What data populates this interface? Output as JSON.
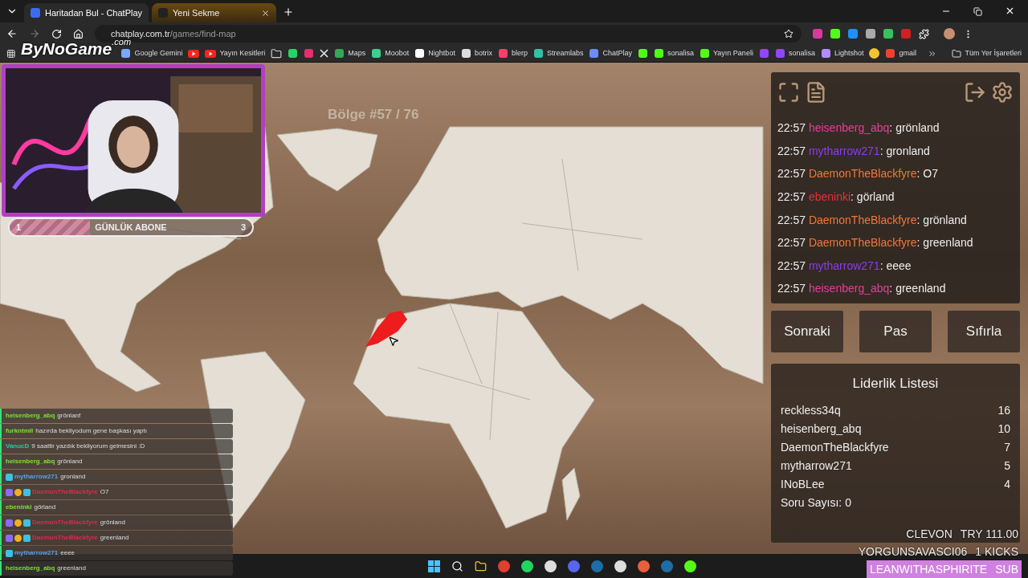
{
  "browser": {
    "tabs": [
      {
        "label": "Haritadan Bul - ChatPlay",
        "selected": true
      },
      {
        "label": "Yeni Sekme",
        "selected": false
      }
    ],
    "address": {
      "host": "chatplay.com.tr",
      "path": "/games/find-map"
    },
    "bookmarks": [
      {
        "kind": "gemini",
        "label": "Google Gemini"
      },
      {
        "kind": "youtube"
      },
      {
        "kind": "youtube",
        "label": "Yayın Kesitleri"
      },
      {
        "kind": "folder"
      },
      {
        "kind": "whatsapp"
      },
      {
        "kind": "instagram"
      },
      {
        "kind": "x"
      },
      {
        "kind": "maps",
        "label": "Maps"
      },
      {
        "kind": "moobot",
        "label": "Moobot"
      },
      {
        "kind": "nightbot",
        "label": "Nightbot"
      },
      {
        "kind": "botrix",
        "label": "botrix"
      },
      {
        "kind": "blerp",
        "label": "blerp"
      },
      {
        "kind": "streamlabs",
        "label": "Streamlabs"
      },
      {
        "kind": "chatplay",
        "label": "ChatPlay"
      },
      {
        "kind": "kick"
      },
      {
        "kind": "kick",
        "label": "sonalisa"
      },
      {
        "kind": "kick",
        "label": "Yayın Paneli"
      },
      {
        "kind": "twitch"
      },
      {
        "kind": "twitch",
        "label": "sonalisa"
      },
      {
        "kind": "lightshot",
        "label": "Lightshot"
      },
      {
        "kind": "emoji"
      },
      {
        "kind": "gmail",
        "label": "gmail"
      }
    ],
    "all_bookmarks": "Tüm Yer İşaretleri"
  },
  "logo": {
    "name": "ByNoGame",
    "suffix": ".com"
  },
  "subscriber_goal": {
    "start": "1",
    "label": "GÜNLÜK ABONE",
    "end": "3",
    "level": 0.33
  },
  "game": {
    "region_counter": "Bölge #57 / 76"
  },
  "chat": {
    "messages": [
      {
        "time": "22:57",
        "user": "heisenberg_abq",
        "color": "#e0409a",
        "text": ": grönland"
      },
      {
        "time": "22:57",
        "user": "mytharrow271",
        "color": "#8a3cf0",
        "text": ": gronland"
      },
      {
        "time": "22:57",
        "user": "DaemonTheBlackfyre",
        "color": "#f07838",
        "text": ": O7"
      },
      {
        "time": "22:57",
        "user": "ebeninki",
        "color": "#e8303a",
        "text": ": görland"
      },
      {
        "time": "22:57",
        "user": "DaemonTheBlackfyre",
        "color": "#f07838",
        "text": ": grönland"
      },
      {
        "time": "22:57",
        "user": "DaemonTheBlackfyre",
        "color": "#f07838",
        "text": ": greenland"
      },
      {
        "time": "22:57",
        "user": "mytharrow271",
        "color": "#8a3cf0",
        "text": ": eeee"
      },
      {
        "time": "22:57",
        "user": "heisenberg_abq",
        "color": "#e0409a",
        "text": ": greenland"
      }
    ]
  },
  "actions": [
    "Sonraki",
    "Pas",
    "Sıfırla"
  ],
  "leaderboard": {
    "title": "Liderlik Listesi",
    "rows": [
      {
        "name": "reckless34q",
        "score": "16"
      },
      {
        "name": "heisenberg_abq",
        "score": "10"
      },
      {
        "name": "DaemonTheBlackfyre",
        "score": "7"
      },
      {
        "name": "mytharrow271",
        "score": "5"
      },
      {
        "name": "INoBLee",
        "score": "4"
      }
    ],
    "question_count": "Soru Sayısı: 0"
  },
  "stream_chat": [
    {
      "kind": "plain",
      "user": "heisenberg_abq",
      "color": "#7ee03a",
      "text": "grönlanf"
    },
    {
      "kind": "plain",
      "user": "furkntmll",
      "color": "#7ee03a",
      "text": "hazırda bekliyodum gene başkası yaptı"
    },
    {
      "kind": "plain",
      "user": "VanucD",
      "color": "#2fc8a0",
      "text": "9 saattir yazdık bekliyorum gelmesini :D"
    },
    {
      "kind": "plain",
      "user": "heisenberg_abq",
      "color": "#7ee03a",
      "text": "grönland"
    },
    {
      "kind": "one_badge",
      "user": "mytharrow271",
      "color": "#5aa0e6",
      "text": "gronland"
    },
    {
      "kind": "three_badges",
      "user": "DaemonTheBlackfyre",
      "color": "#e0284a",
      "text": "O7"
    },
    {
      "kind": "plain",
      "user": "ebeninki",
      "color": "#7ee03a",
      "text": "görland"
    },
    {
      "kind": "three_badges",
      "user": "DaemonTheBlackfyre",
      "color": "#e0284a",
      "text": "grönland"
    },
    {
      "kind": "three_badges",
      "user": "DaemonTheBlackfyre",
      "color": "#e0284a",
      "text": "greenland"
    },
    {
      "kind": "one_badge",
      "user": "mytharrow271",
      "color": "#5aa0e6",
      "text": "eeee"
    },
    {
      "kind": "plain",
      "user": "heisenberg_abq",
      "color": "#7ee03a",
      "text": "greenland"
    }
  ],
  "alerts": [
    {
      "kind": "plain",
      "name": "CLEVON",
      "detail": "TRY 111.00"
    },
    {
      "kind": "plain",
      "name": "YORGUNSAVASCI06",
      "detail": "1 KICKS"
    },
    {
      "kind": "highlight",
      "name": "LEANWITHASPHIRITE",
      "detail": "SUB"
    }
  ]
}
